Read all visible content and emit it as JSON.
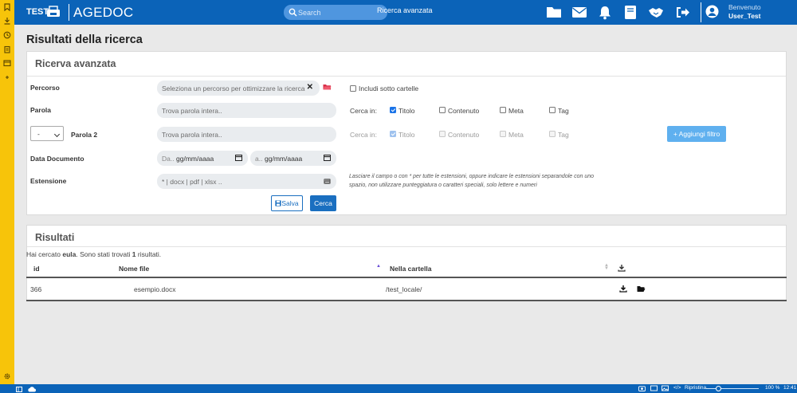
{
  "header": {
    "brand_prefix": "TEST",
    "app_name": "AGEDOC",
    "search_placeholder": "Search",
    "advanced_search": "Ricerca avanzata",
    "icons": [
      "folder-icon",
      "mail-icon",
      "bell-icon",
      "book-icon",
      "handshake-icon",
      "logout-icon"
    ],
    "welcome": "Benvenuto",
    "username": "User_Test"
  },
  "page_title": "Risultati della ricerca",
  "advanced": {
    "title": "Ricerva avanzata",
    "percorso_label": "Percorso",
    "percorso_placeholder": "Seleziona un percorso per ottimizzare la ricerca",
    "subfolders_label": "Includi sotto cartelle",
    "parola_label": "Parola",
    "parola_placeholder": "Trova parola intera..",
    "cerca_in": "Cerca in:",
    "options": [
      "Titolo",
      "Contenuto",
      "Meta",
      "Tag"
    ],
    "options_checked": [
      true,
      false,
      false,
      false
    ],
    "operator_value": "-",
    "parola2_label": "Parola 2",
    "parola2_placeholder": "Trova parola intera..",
    "options2_checked": [
      true,
      false,
      false,
      false
    ],
    "add_filter": "+ Aggiungi filtro",
    "data_label": "Data Documento",
    "date_from_prefix": "Da..",
    "date_to_prefix": "a..",
    "date_placeholder": "gg/mm/aaaa",
    "estensione_label": "Estensione",
    "estensione_placeholder": "* | docx | pdf | xlsx ..",
    "hint": "Lasciare il campo o con * per tutte le estensioni, oppure indicare le estensioni separandole con uno spazio, non utilizzare punteggiatura o caratteri speciali, solo lettere e numeri",
    "save": "Salva",
    "search": "Cerca"
  },
  "results": {
    "title": "Risultati",
    "info_prefix": "Hai cercato ",
    "query": "eula",
    "info_middle": ". Sono stati trovati ",
    "count": "1",
    "info_suffix": " risultati.",
    "columns": [
      "id",
      "Nome file",
      "Nella cartella"
    ],
    "rows": [
      {
        "id": "366",
        "name": "esempio.docx",
        "folder": "/test_locale/"
      }
    ]
  },
  "taskbar": {
    "restore": "Ripristina",
    "zoom": "100 %",
    "time": "12:41"
  }
}
